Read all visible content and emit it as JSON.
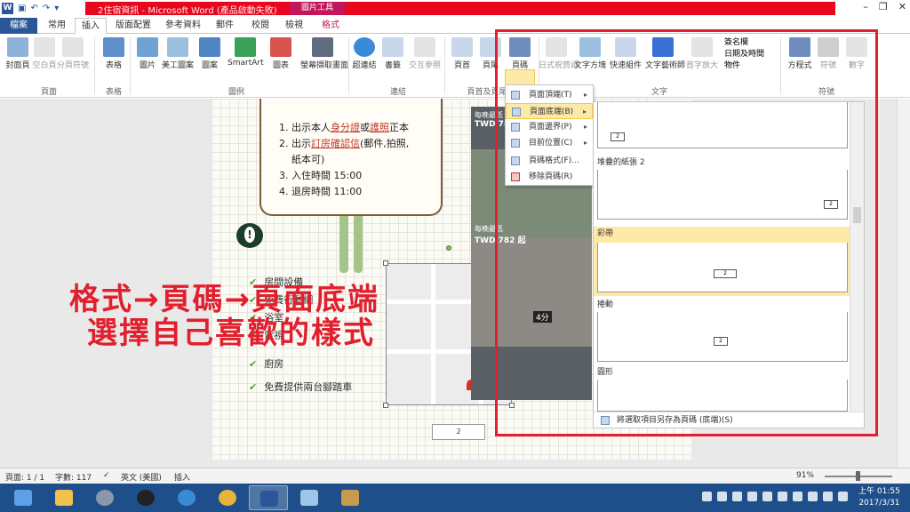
{
  "window": {
    "doc_title": "2住宿資訊 - Microsoft Word (產品啟動失敗)",
    "context_title": "圖片工具"
  },
  "tabs": [
    "檔案",
    "常用",
    "插入",
    "版面配置",
    "參考資料",
    "郵件",
    "校閱",
    "檢視",
    "格式"
  ],
  "ribbon": {
    "buttons": [
      {
        "label": "封面頁",
        "dim": false
      },
      {
        "label": "空白頁",
        "dim": true
      },
      {
        "label": "分頁符號",
        "dim": true
      },
      {
        "label": "表格",
        "dim": false
      },
      {
        "label": "圖片",
        "dim": false
      },
      {
        "label": "美工圖案",
        "dim": false
      },
      {
        "label": "圖案",
        "dim": false
      },
      {
        "label": "SmartArt",
        "dim": false
      },
      {
        "label": "圖表",
        "dim": false
      },
      {
        "label": "螢幕擷取畫面",
        "dim": false
      },
      {
        "label": "超連結",
        "dim": false
      },
      {
        "label": "書籤",
        "dim": false
      },
      {
        "label": "交互參照",
        "dim": true
      },
      {
        "label": "頁首",
        "dim": false
      },
      {
        "label": "頁尾",
        "dim": false
      },
      {
        "label": "頁碼",
        "dim": false
      },
      {
        "label": "日式祝賀詞",
        "dim": true
      },
      {
        "label": "文字方塊",
        "dim": false
      },
      {
        "label": "快速組件",
        "dim": false
      },
      {
        "label": "文字藝術師",
        "dim": false
      },
      {
        "label": "首字放大",
        "dim": true
      },
      {
        "label": "方程式",
        "dim": false
      },
      {
        "label": "符號",
        "dim": true
      },
      {
        "label": "數字",
        "dim": true
      }
    ],
    "small_buttons": [
      "簽名欄",
      "日期及時間",
      "物件"
    ],
    "groups": [
      "頁面",
      "表格",
      "圖例",
      "連結",
      "頁首及頁尾",
      "文字",
      "符號"
    ]
  },
  "document": {
    "note_lines": [
      {
        "n": "1.",
        "pre": "出示本人",
        "u1": "身分證",
        "mid": "或",
        "u2": "護照",
        "post": "正本"
      },
      {
        "n": "2.",
        "pre": "出示",
        "u1": "訂房確認信",
        "mid": "(郵件,拍照,",
        "u2": "",
        "post": ""
      },
      {
        "n": "",
        "pre": "紙本可)",
        "u1": "",
        "mid": "",
        "u2": "",
        "post": ""
      },
      {
        "n": "3.",
        "pre": "入住時間 15:00",
        "u1": "",
        "mid": "",
        "u2": "",
        "post": ""
      },
      {
        "n": "4.",
        "pre": "退房時間 11:00",
        "u1": "",
        "mid": "",
        "u2": "",
        "post": ""
      }
    ],
    "list_items": [
      "房間設備",
      "免費行動網",
      "浴室",
      "電視",
      "廚房",
      "免費提供兩台腳踏車"
    ],
    "footer_badge": "2",
    "overlay_line1": "格式→頁碼→頁面底端",
    "overlay_line2": "選擇自己喜歡的樣式",
    "photo_labels": [
      {
        "title": "每晚最低",
        "price": "TWD 782"
      },
      {
        "title": "每晚最低",
        "price": "TWD 782 起"
      }
    ],
    "map_time": "4分"
  },
  "menu": {
    "items": [
      {
        "label": "頁面頂端(T)",
        "arrow": true,
        "highlight": false
      },
      {
        "label": "頁面底端(B)",
        "arrow": true,
        "highlight": true
      },
      {
        "label": "頁面邊界(P)",
        "arrow": true,
        "highlight": false
      },
      {
        "label": "目前位置(C)",
        "arrow": true,
        "highlight": false
      },
      {
        "label": "頁碼格式(F)...",
        "arrow": false,
        "highlight": false
      },
      {
        "label": "移除頁碼(R)",
        "arrow": false,
        "highlight": false
      }
    ]
  },
  "gallery": {
    "items": [
      {
        "title": "",
        "num": "2",
        "highlight": false
      },
      {
        "title": "堆疊的紙張 2",
        "num": "2",
        "highlight": false
      },
      {
        "title": "彩帶",
        "num": "2",
        "highlight": true
      },
      {
        "title": "捲動",
        "num": "2",
        "highlight": false
      },
      {
        "title": "圓形",
        "num": "",
        "highlight": false
      }
    ],
    "footer": "將選取項目另存為頁碼 (底端)(S)"
  },
  "status": {
    "page": "頁面: 1 / 1",
    "words": "字數: 117",
    "lang": "英文 (美國)",
    "mode": "插入",
    "zoom": "91%"
  },
  "clock": {
    "time": "上午 01:55",
    "date": "2017/3/31"
  },
  "colors": {
    "accent": "#2b579a",
    "highlight": "#fde9a8",
    "annotation": "#e11f2d",
    "taskbar": "#1e4f8a"
  }
}
